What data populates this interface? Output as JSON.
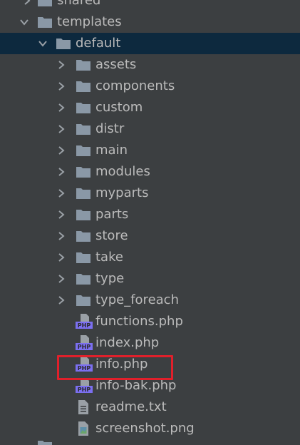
{
  "tree": {
    "shared": {
      "label": "shared",
      "icon": "folder-icon",
      "state": "collapsed"
    },
    "templates": {
      "label": "templates",
      "icon": "folder-icon",
      "state": "expanded"
    },
    "default": {
      "label": "default",
      "icon": "folder-icon",
      "state": "expanded",
      "selected": true
    },
    "folders": [
      {
        "label": "assets",
        "icon": "folder-icon"
      },
      {
        "label": "components",
        "icon": "folder-icon"
      },
      {
        "label": "custom",
        "icon": "folder-icon"
      },
      {
        "label": "distr",
        "icon": "folder-icon"
      },
      {
        "label": "main",
        "icon": "folder-icon"
      },
      {
        "label": "modules",
        "icon": "folder-icon"
      },
      {
        "label": "myparts",
        "icon": "folder-icon"
      },
      {
        "label": "parts",
        "icon": "folder-icon"
      },
      {
        "label": "store",
        "icon": "folder-icon"
      },
      {
        "label": "take",
        "icon": "folder-icon"
      },
      {
        "label": "type",
        "icon": "folder-icon"
      },
      {
        "label": "type_foreach",
        "icon": "folder-icon"
      }
    ],
    "files": [
      {
        "label": "functions.php",
        "icon": "php-file-icon"
      },
      {
        "label": "index.php",
        "icon": "php-file-icon"
      },
      {
        "label": "info.php",
        "icon": "php-file-icon",
        "highlighted": true
      },
      {
        "label": "info-bak.php",
        "icon": "php-file-icon"
      },
      {
        "label": "readme.txt",
        "icon": "text-file-icon"
      },
      {
        "label": "screenshot.png",
        "icon": "image-file-icon"
      }
    ]
  },
  "colors": {
    "background": "#3c3f41",
    "selection": "#0d293e",
    "text": "#bbbbbb",
    "folder": "#8a98a6",
    "php_badge": "#7b6ff0",
    "highlight_border": "#e0202b"
  }
}
